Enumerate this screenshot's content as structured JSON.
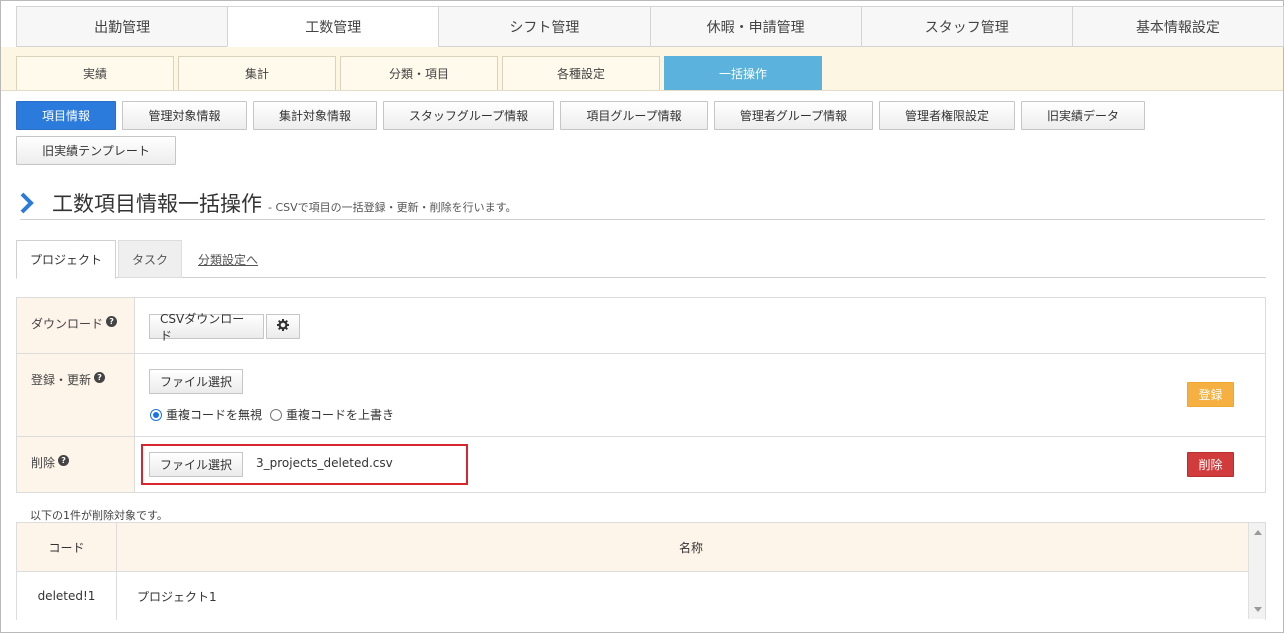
{
  "topnav": [
    "出勤管理",
    "工数管理",
    "シフト管理",
    "休暇・申請管理",
    "スタッフ管理",
    "基本情報設定"
  ],
  "subnav": [
    "実績",
    "集計",
    "分類・項目",
    "各種設定",
    "一括操作"
  ],
  "buttons": [
    "項目情報",
    "管理対象情報",
    "集計対象情報",
    "スタッフグループ情報",
    "項目グループ情報",
    "管理者グループ情報",
    "管理者権限設定",
    "旧実績データ",
    "旧実績テンプレート"
  ],
  "heading": {
    "title": "工数項目情報一括操作",
    "subtitle": "- CSVで項目の一括登録・更新・削除を行います。"
  },
  "tabs": {
    "project": "プロジェクト",
    "task": "タスク",
    "link": "分類設定へ"
  },
  "form": {
    "download": {
      "label": "ダウンロード",
      "csv_button": "CSVダウンロード"
    },
    "register": {
      "label": "登録・更新",
      "file_button": "ファイル選択",
      "radio_ignore": "重複コードを無視",
      "radio_overwrite": "重複コードを上書き",
      "submit": "登録"
    },
    "delete": {
      "label": "削除",
      "file_button": "ファイル選択",
      "filename": "3_projects_deleted.csv",
      "submit": "削除"
    }
  },
  "note": "以下の1件が削除対象です。",
  "table": {
    "headers": [
      "コード",
      "名称"
    ],
    "rows": [
      {
        "code": "deleted!1",
        "name": "プロジェクト1"
      }
    ]
  }
}
